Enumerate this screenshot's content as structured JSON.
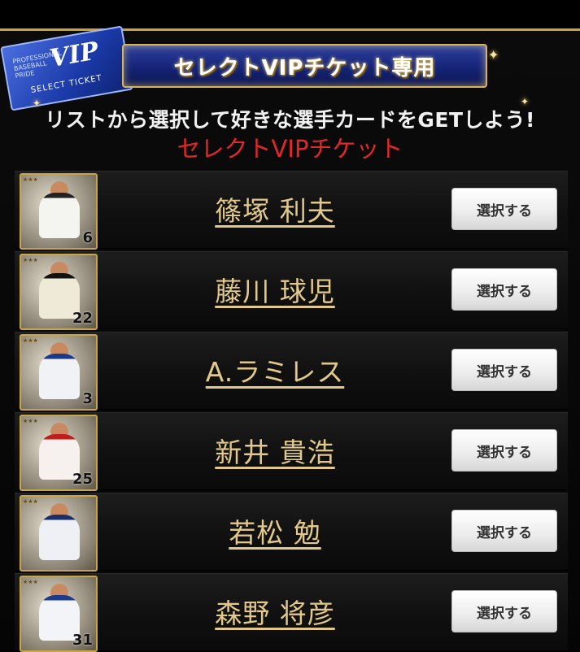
{
  "header": {
    "ticket_logo": {
      "vip": "VIP",
      "small_text": "PROFESSIONAL BASEBALL PRIDE",
      "select_text": "SELECT TICKET"
    },
    "banner_title": "セレクトVIPチケット専用"
  },
  "instruction": "リストから選択して好きな選手カードをGETしよう!",
  "subtitle": "セレクトVIPチケット",
  "players": [
    {
      "name": "篠塚 利夫",
      "number": "6",
      "button": "選択する",
      "uniform_color": "#f4f4f0",
      "cap_color": "#222"
    },
    {
      "name": "藤川 球児",
      "number": "22",
      "button": "選択する",
      "uniform_color": "#efe9d8",
      "cap_color": "#111"
    },
    {
      "name": "A.ラミレス",
      "number": "3",
      "button": "選択する",
      "uniform_color": "#f0f2f6",
      "cap_color": "#1c3a8a"
    },
    {
      "name": "新井 貴浩",
      "number": "25",
      "button": "選択する",
      "uniform_color": "#f6f1ef",
      "cap_color": "#c21c1c"
    },
    {
      "name": "若松 勉",
      "number": "",
      "button": "選択する",
      "uniform_color": "#eef0f6",
      "cap_color": "#1a2f6a"
    },
    {
      "name": "森野 将彦",
      "number": "31",
      "button": "選択する",
      "uniform_color": "#f2f4f8",
      "cap_color": "#1b3b8e"
    }
  ]
}
